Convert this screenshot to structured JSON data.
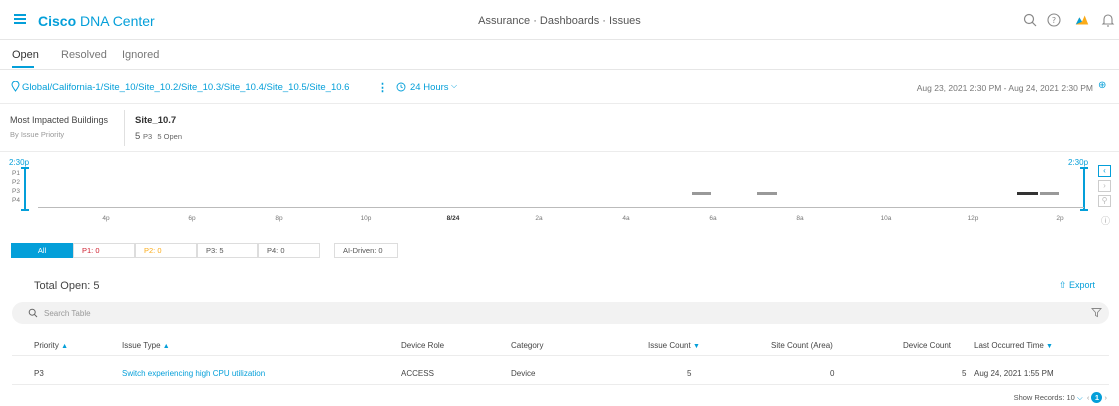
{
  "header": {
    "brand_bold": "Cisco",
    "brand_rest": "DNA Center",
    "breadcrumb": "Assurance · Dashboards · Issues",
    "icons": [
      "search-icon",
      "help-icon",
      "warning-icon",
      "bell-icon"
    ],
    "accent_color": "#049fd9",
    "warning_color": "#fbab18"
  },
  "tabs": [
    "Open",
    "Resolved",
    "Ignored"
  ],
  "filters": {
    "site_path": "Global/California-1/Site_10/Site_10.2/Site_10.3/Site_10.4/Site_10.5/Site_10.6",
    "time_range": "24 Hours",
    "date_range": "Aug 23, 2021 2:30 PM - Aug 24, 2021 2:30 PM"
  },
  "most_impacted": {
    "label": "Most Impacted Buildings",
    "sublabel": "By Issue Priority",
    "building": "Site_10.7",
    "count": "5",
    "priority": "P3",
    "open_text": "5 Open"
  },
  "timeline": {
    "start_time": "2:30p",
    "end_time": "2:30p",
    "priorities": [
      "P1",
      "P2",
      "P3",
      "P4"
    ],
    "ticks": [
      "4p",
      "6p",
      "8p",
      "10p",
      "8/24",
      "2a",
      "4a",
      "6a",
      "8a",
      "10a",
      "12p",
      "2p"
    ]
  },
  "priority_filters": {
    "all": "All",
    "p1": "P1: 0",
    "p2": "P2: 0",
    "p3": "P3: 5",
    "p4": "P4: 0",
    "ai": "AI-Driven: 0",
    "p1_color": "#cf2030",
    "p2_color": "#fbab18"
  },
  "table": {
    "total_label": "Total Open: 5",
    "export_label": "Export",
    "search_placeholder": "Search Table",
    "columns": [
      "Priority",
      "Issue Type",
      "Device Role",
      "Category",
      "Issue Count",
      "Site Count (Area)",
      "Device Count",
      "Last Occurred Time"
    ],
    "rows": [
      {
        "priority": "P3",
        "issue_type": "Switch experiencing high CPU utilization",
        "device_role": "ACCESS",
        "category": "Device",
        "issue_count": "5",
        "site_count": "0",
        "device_count": "5",
        "last_occurred": "Aug 24, 2021 1:55 PM"
      }
    ],
    "show_records_label": "Show Records: 10",
    "current_page": "1"
  }
}
